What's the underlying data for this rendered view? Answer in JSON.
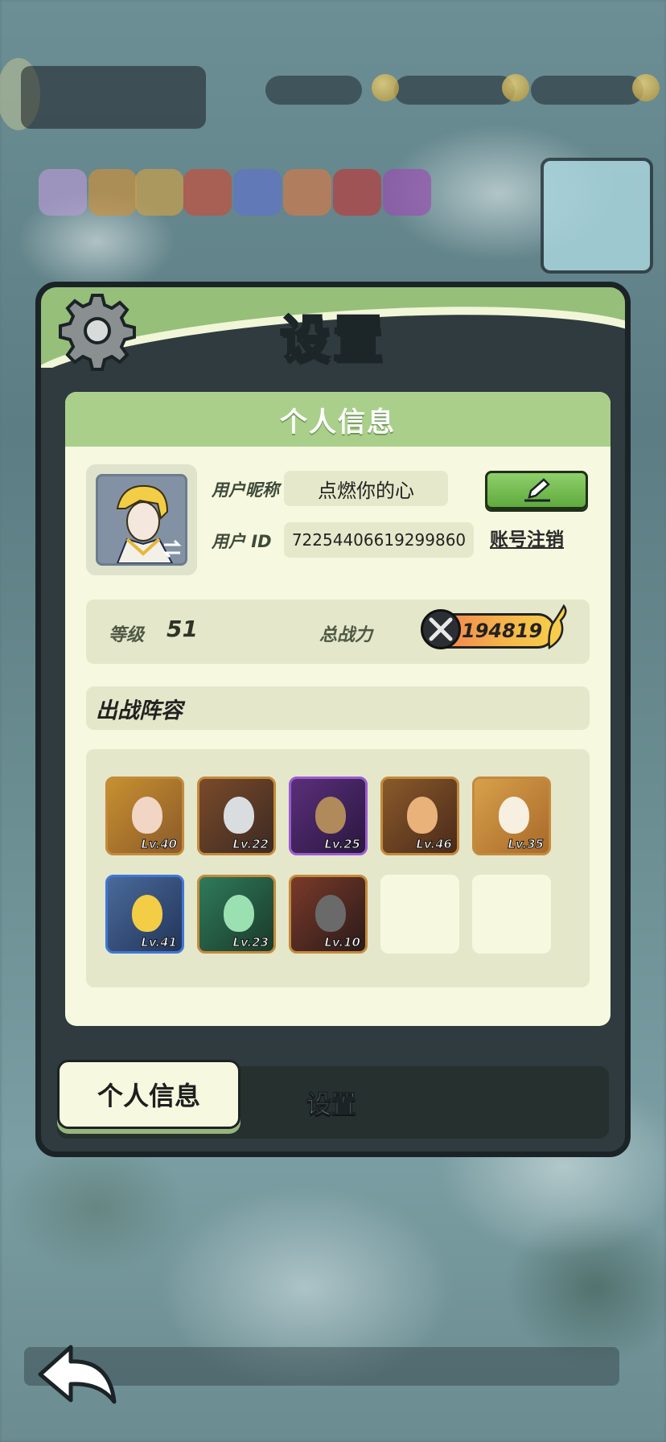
{
  "modal": {
    "title": "设置"
  },
  "panel": {
    "header": "个人信息"
  },
  "profile": {
    "nickname_label": "用户昵称",
    "nickname": "点燃你的心",
    "id_label": "用户 ID",
    "user_id": "72254406619299860",
    "cancel_account": "账号注销"
  },
  "stats": {
    "level_label": "等级",
    "level": "51",
    "power_label": "总战力",
    "power": "194819"
  },
  "lineup": {
    "title": "出战阵容",
    "heroes": [
      {
        "lv": "Lv.40",
        "color": "#c48a3c"
      },
      {
        "lv": "Lv.22",
        "color": "#c48a3c"
      },
      {
        "lv": "Lv.25",
        "color": "#9b5bd0"
      },
      {
        "lv": "Lv.46",
        "color": "#c48a3c"
      },
      {
        "lv": "Lv.35",
        "color": "#c48a3c"
      },
      {
        "lv": "Lv.41",
        "color": "#3f76d8"
      },
      {
        "lv": "Lv.23",
        "color": "#c48a3c"
      },
      {
        "lv": "Lv.10",
        "color": "#c48a3c"
      }
    ]
  },
  "tabs": {
    "active": "个人信息",
    "inactive": "设置"
  },
  "colors": {
    "accent_green": "#96bf7a",
    "panel_bg": "#f6f9df",
    "frame": "#1b2326"
  }
}
